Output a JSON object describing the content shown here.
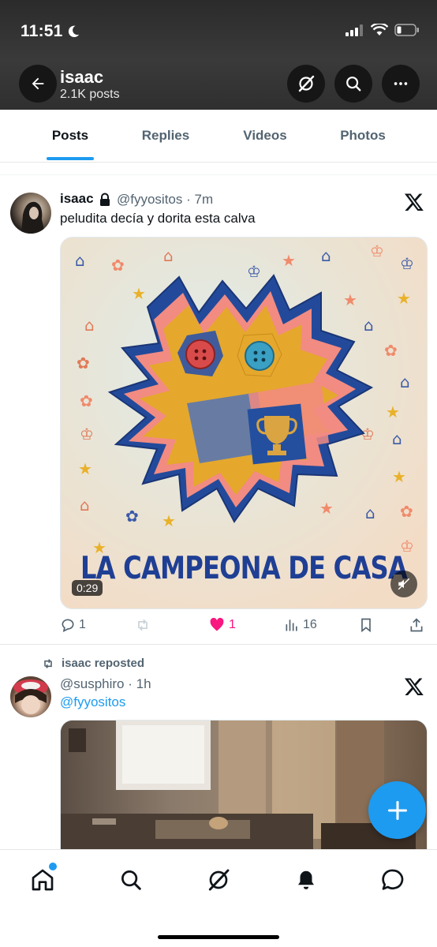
{
  "status_bar": {
    "time": "11:51"
  },
  "header": {
    "name": "isaac",
    "posts_count": "2.1K posts"
  },
  "tabs": [
    {
      "label": "Posts",
      "active": true
    },
    {
      "label": "Replies",
      "active": false
    },
    {
      "label": "Videos",
      "active": false
    },
    {
      "label": "Photos",
      "active": false
    }
  ],
  "post1": {
    "name": "isaac",
    "meta": "@fyyositos · 7m",
    "text": "peludita decía y dorita esta calva",
    "video_title": "LA CAMPEONA DE CASA",
    "duration": "0:29",
    "replies": "1",
    "likes": "1",
    "views": "16"
  },
  "post2": {
    "repost_label": "isaac reposted",
    "meta": "@susphiro · 1h",
    "mention": "@fyyositos"
  },
  "colors": {
    "accent": "#1d9bf0",
    "like": "#f91880",
    "text": "#0f1419",
    "muted": "#536471"
  },
  "icons": {
    "header": [
      "back-arrow-icon",
      "grok-icon",
      "search-icon",
      "more-icon"
    ],
    "nav": [
      "home-icon",
      "search-icon",
      "grok-icon",
      "notifications-icon",
      "messages-icon"
    ]
  }
}
